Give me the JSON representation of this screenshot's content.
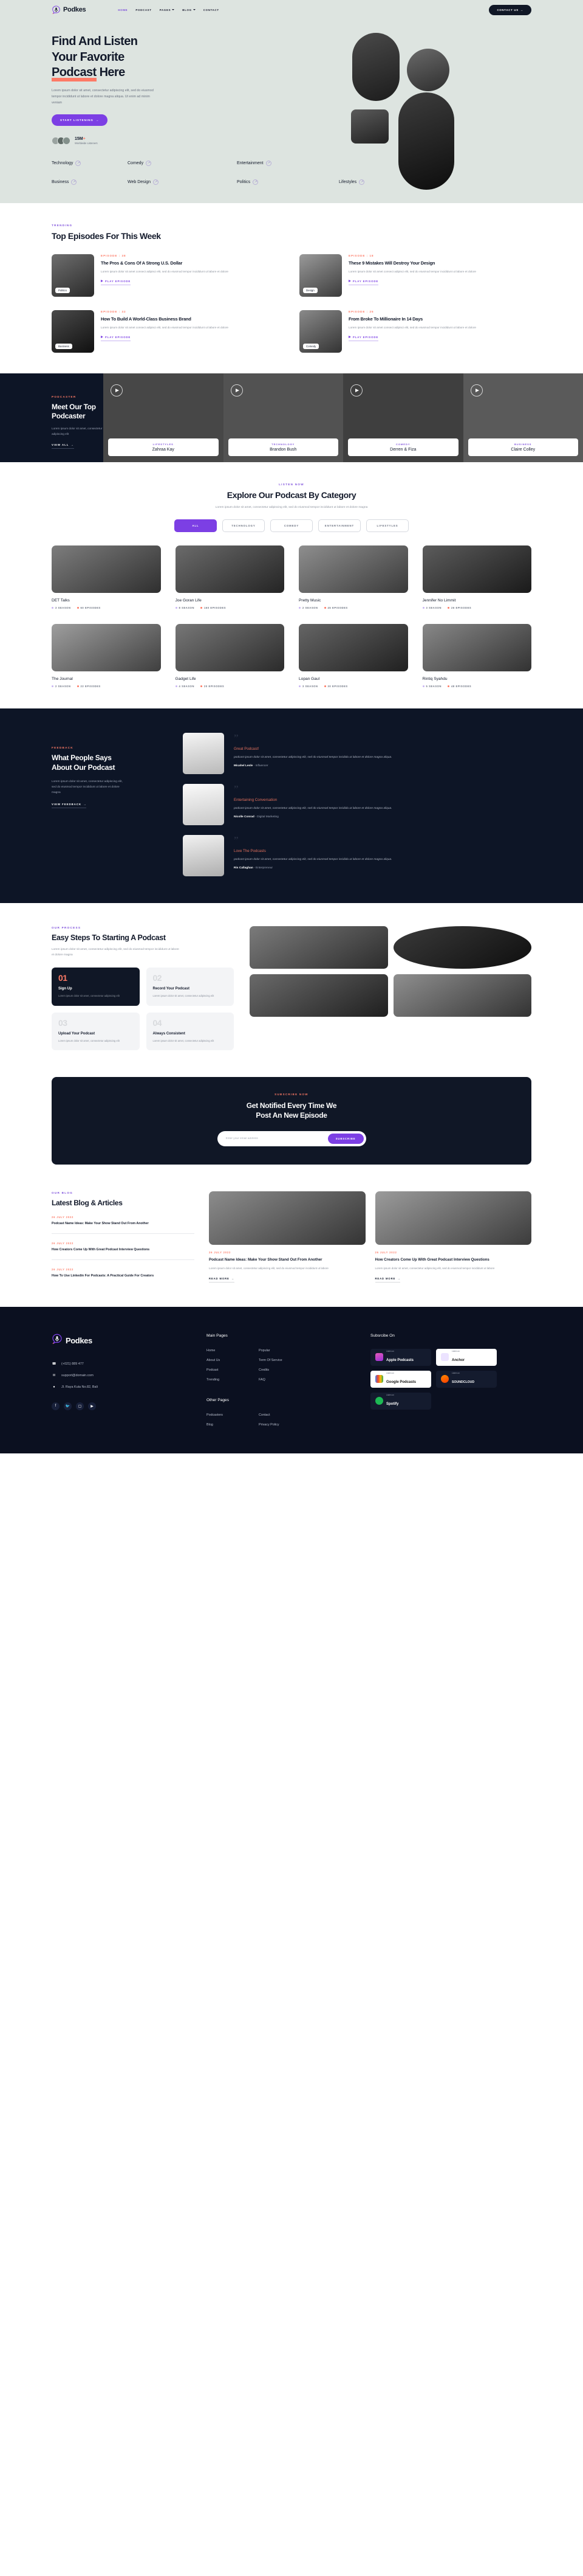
{
  "brand": {
    "name": "Podkes"
  },
  "nav": {
    "links": [
      {
        "label": "HOME",
        "active": true,
        "caret": false
      },
      {
        "label": "PODCAST",
        "active": false,
        "caret": false
      },
      {
        "label": "PAGES",
        "active": false,
        "caret": true
      },
      {
        "label": "BLOG",
        "active": false,
        "caret": true
      },
      {
        "label": "CONTACT",
        "active": false,
        "caret": false
      }
    ],
    "cta": "CONTACT US"
  },
  "hero": {
    "title_line1": "Find And Listen",
    "title_line2": "Your Favorite",
    "title_highlight": "Podcast",
    "title_tail": " Here",
    "paragraph": "Lorem ipsum dolor sit amet, consectetur adipiscing elit, sed do eiusmod tempor incididunt ut labore et dolore magna aliqua. Ut enim ad minim veniam",
    "cta": "START LISTENING",
    "stat_number": "15M",
    "stat_plus": "+",
    "stat_label": "Worldwide Listeners"
  },
  "categories": [
    [
      "Technology",
      "Comedy",
      "Entertainment"
    ],
    [
      "Business",
      "Web Design",
      "Politics",
      "Lifestyles"
    ]
  ],
  "episodes": {
    "eyebrow": "TRENDING",
    "title": "Top Episodes For This Week",
    "play_label": "PLAY EPISODE",
    "items": [
      {
        "meta": "EPISODE : 38",
        "tag": "Politics",
        "title": "The Pros & Cons Of A Strong U.S. Dollar",
        "desc": "Lorem ipsum dolor sit amet consect adipisci elit, sed do eiusmod tempor incididunt ut labore et dolore"
      },
      {
        "meta": "EPISODE : 18",
        "tag": "Design",
        "title": "These 9 Mistakes Will Destroy Your Design",
        "desc": "Lorem ipsum dolor sit amet consect adipisci elit, sed do eiusmod tempor incididunt ut labore et dolore"
      },
      {
        "meta": "EPISODE : 32",
        "tag": "Business",
        "title": "How To Build A World-Class Business Brand",
        "desc": "Lorem ipsum dolor sit amet consect adipisci elit, sed do eiusmod tempor incididunt ut labore et dolore"
      },
      {
        "meta": "EPISODE : 25",
        "tag": "Comedy",
        "title": "From Broke To Millionaire In 14 Days",
        "desc": "Lorem ipsum dolor sit amet consect adipisci elit, sed do eiusmod tempor incididunt ut labore et dolore"
      }
    ]
  },
  "podcaster": {
    "eyebrow": "PODCASTER",
    "title_line1": "Meet Our Top",
    "title_line2": "Podcaster",
    "paragraph": "Lorem ipsum dolor sit amet, consectetur adipiscing elit",
    "link": "VIEW ALL",
    "slides": [
      {
        "category": "LIFESTYLES",
        "name": "Zahraa Kay"
      },
      {
        "category": "TECHNOLOGY",
        "name": "Brandon Bush"
      },
      {
        "category": "COMEDY",
        "name": "Derren & Fiza"
      },
      {
        "category": "BUSINESS",
        "name": "Claire Colley"
      }
    ]
  },
  "explore": {
    "eyebrow": "LISTEN NOW",
    "title": "Explore Our Podcast By Category",
    "subtitle": "Lorem ipsum dolor sit amet, consectetur adipiscing elit, sed do eiusmod tempor incididunt ut labore et dolore magna",
    "filters": [
      {
        "label": "ALL",
        "active": true
      },
      {
        "label": "TECHNOLOGY",
        "active": false
      },
      {
        "label": "COMEDY",
        "active": false
      },
      {
        "label": "ENTERTAINMENT",
        "active": false
      },
      {
        "label": "LIFESTYLES",
        "active": false
      }
    ],
    "podcasts": [
      {
        "name": "DET Talks",
        "seasons": "3 SEASON",
        "episodes": "60 EPISODES"
      },
      {
        "name": "Joe Goran Life",
        "seasons": "8 SEASON",
        "episodes": "160 EPISODES"
      },
      {
        "name": "Pretty Music",
        "seasons": "2 SEASON",
        "episodes": "45 EPISODES"
      },
      {
        "name": "Jennifer No Limmit",
        "seasons": "3 SEASON",
        "episodes": "26 EPISODES"
      },
      {
        "name": "The Journal",
        "seasons": "2 SEASON",
        "episodes": "22 EPISODES"
      },
      {
        "name": "Gadget Life",
        "seasons": "4 SEASON",
        "episodes": "20 EPISODES"
      },
      {
        "name": "Lopan Gaul",
        "seasons": "3 SEASON",
        "episodes": "30 EPISODES"
      },
      {
        "name": "Rintiq Syahdu",
        "seasons": "5 SEASON",
        "episodes": "48 EPISODES"
      }
    ]
  },
  "feedback": {
    "eyebrow": "FEEDBACK",
    "title_line1": "What People Says",
    "title_line2": "About Our Podcast",
    "paragraph": "Lorem ipsum dolor sit amet, consectetur adipiscing elit, sed do eiusmod tempor incididunt ut labore et dolore magna",
    "link": "VIEW FEEDBACK",
    "quote_glyph": "”",
    "items": [
      {
        "heading": "Great Podcast!",
        "text": "podcast ipsum dolor sit amet, consectetur adipiscing elit, sed do eiusmod tempor incididu ut labore et dolore magna aliqua.",
        "author": "Micahel Lesle",
        "role": " - Influencer"
      },
      {
        "heading": "Entertaining Conversation",
        "text": "podcast ipsum dolor sit amet, consectetur adipiscing elit, sed do eiusmod tempor incididu ut labore et dolore magna aliqua.",
        "author": "Nicolle Conrad",
        "role": " - Digital Marketing"
      },
      {
        "heading": "Love The Podcasts",
        "text": "podcast ipsum dolor sit amet, consectetur adipiscing elit, sed do eiusmod tempor incididu ut labore et dolore magna aliqua.",
        "author": "Ris Callaghan",
        "role": " - Enterpreneur"
      }
    ]
  },
  "steps": {
    "eyebrow": "OUR PROCESS",
    "title": "Easy Steps To Starting A Podcast",
    "paragraph": "Lorem ipsum dolor sit amet, consectetur adipiscing elit, sed do eiusmod tempor incididunt ut labore et dolore magna",
    "items": [
      {
        "num": "01",
        "name": "Sign Up",
        "desc": "Lorem ipsum dolor sit amet, consectetur adipiscing elit",
        "dark": true
      },
      {
        "num": "02",
        "name": "Record Your Podcast",
        "desc": "Lorem ipsum dolor sit amet, consectetur adipiscing elit",
        "dark": false
      },
      {
        "num": "03",
        "name": "Upload Your Podcast",
        "desc": "Lorem ipsum dolor sit amet, consectetur adipiscing elit",
        "dark": false
      },
      {
        "num": "04",
        "name": "Always Consistent",
        "desc": "Lorem ipsum dolor sit amet, consectetur adipiscing elit",
        "dark": false
      }
    ]
  },
  "newsletter": {
    "eyebrow": "SUBSCRIBE NOW",
    "title_line1": "Get Notified Every Time We",
    "title_line2": "Post An New Episode",
    "placeholder": "Enter your email address",
    "value": "",
    "button": "SUBSCRIBE"
  },
  "blog": {
    "eyebrow": "OUR BLOG",
    "title": "Latest Blog & Articles",
    "read_more": "READ MORE",
    "list": [
      {
        "date": "26 JULY 2022",
        "head": "Podcast Name Ideas: Make Your Show Stand Out From Another"
      },
      {
        "date": "26 JULY 2022",
        "head": "How Creators Come Up With Great Podcast Interview Questions"
      },
      {
        "date": "26 JULY 2022",
        "head": "How To Use Linkedin For Podcasts: A Practical Guide For Creators"
      }
    ],
    "featured": [
      {
        "date": "26 JULY 2022",
        "head": "Podcast Name Ideas: Make Your Show Stand Out From Another",
        "desc": "Lorem ipsum dolor sit amet, consectetur adipiscing elit, sed do eiusmod tempor incididunt ut labore"
      },
      {
        "date": "26 JULY 2022",
        "head": "How Creators Come Up With Great Podcast Interview Questions",
        "desc": "Lorem ipsum dolor sit amet, consectetur adipiscing elit, sed do eiusmod tempor incididunt ut labore"
      }
    ]
  },
  "footer": {
    "phone": "(+021) 889 477",
    "email": "support@domain.com",
    "address": "Jl. Raya Kuta No.82, Bali",
    "socials": [
      "facebook-icon",
      "twitter-icon",
      "instagram-icon",
      "youtube-icon"
    ],
    "main_heading": "Main Pages",
    "main_col1": [
      "Home",
      "About Us",
      "Podcast",
      "Trending"
    ],
    "main_col2": [
      "Popular",
      "Term Of Service",
      "Credits",
      "FAQ"
    ],
    "other_heading": "Other Pages",
    "other_col1": [
      "Podcasters",
      "Blog"
    ],
    "other_col2": [
      "Contact",
      "Privacy Policy"
    ],
    "subscribe_heading": "Subsrcibe On",
    "badges": [
      {
        "small": "Listen on",
        "big": "Apple Podcasts",
        "light": false,
        "color": "#c13584"
      },
      {
        "small": "Listen on",
        "big": "Anchor",
        "light": true,
        "color": "#8a45ff"
      },
      {
        "small": "Listen on",
        "big": "Google Podcasts",
        "light": true,
        "color": "#4285f4"
      },
      {
        "small": "Listen on",
        "big": "SOUNDCLOUD",
        "light": false,
        "color": "#ff5500"
      },
      {
        "small": "Listen on",
        "big": "Spotify",
        "light": false,
        "color": "#1db954"
      }
    ]
  },
  "colors": {
    "accent": "#7c3fe4",
    "coral": "#fd7a66",
    "dark": "#0d1526",
    "hero_bg": "#dde4e0"
  }
}
